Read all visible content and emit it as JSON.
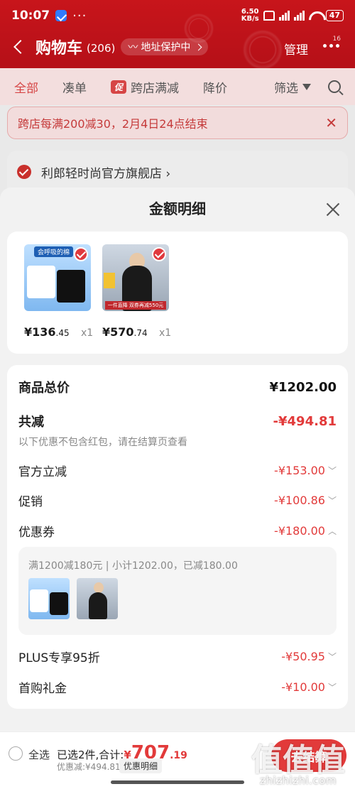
{
  "status_bar": {
    "time": "10:07",
    "speed_value": "6.50",
    "speed_unit": "KB/s",
    "battery": "47"
  },
  "navbar": {
    "title": "购物车",
    "count": "(206)",
    "address_label": "地址保护中",
    "manage": "管理",
    "more_badge": "16"
  },
  "tabs": [
    {
      "label": "全部",
      "active": true
    },
    {
      "label": "凑单",
      "active": false
    },
    {
      "label": "跨店满减",
      "mark": "促",
      "active": false
    },
    {
      "label": "降价",
      "active": false
    },
    {
      "label": "筛选",
      "active": false
    }
  ],
  "notice": {
    "text": "跨店每满200减30，2月4日24点结束"
  },
  "shop": {
    "name": "利郎轻时尚官方旗舰店 ›"
  },
  "sheet": {
    "title": "金额明细",
    "products": [
      {
        "price_int": "¥136",
        "price_dec": ".45",
        "qty": "x1",
        "thumb_label": "会呼吸的棉"
      },
      {
        "price_int": "¥570",
        "price_dec": ".74",
        "qty": "x1",
        "thumb_label": "一件直降 双券再减550元"
      }
    ],
    "total": {
      "label": "商品总价",
      "value": "¥1202.00"
    },
    "reduce": {
      "label": "共减",
      "value": "-¥494.81",
      "note": "以下优惠不包含红包，请在结算页查看"
    },
    "items": [
      {
        "label": "官方立减",
        "value": "-¥153.00",
        "arrow": "﹀"
      },
      {
        "label": "促销",
        "value": "-¥100.86",
        "arrow": "﹀"
      },
      {
        "label": "优惠券",
        "value": "-¥180.00",
        "arrow": "︿"
      }
    ],
    "coupon": {
      "desc": "满1200减180元 | 小计1202.00，已减180.00"
    },
    "items2": [
      {
        "label": "PLUS专享95折",
        "value": "-¥50.95",
        "arrow": "﹀"
      },
      {
        "label": "首购礼金",
        "value": "-¥10.00",
        "arrow": "﹀"
      }
    ]
  },
  "bottom": {
    "select_all": "全选",
    "summary_prefix": "已选2件,合计:",
    "currency": "¥",
    "amount_int": "707",
    "amount_dec": ".19",
    "saved": "优惠减:¥494.81",
    "detail": "优惠明细",
    "checkout": "去结算"
  },
  "watermark": {
    "glyph": "值",
    "site": "zhizhizhi.com"
  },
  "colors": {
    "brand_red": "#c8151b",
    "price_red": "#e23a3a"
  }
}
